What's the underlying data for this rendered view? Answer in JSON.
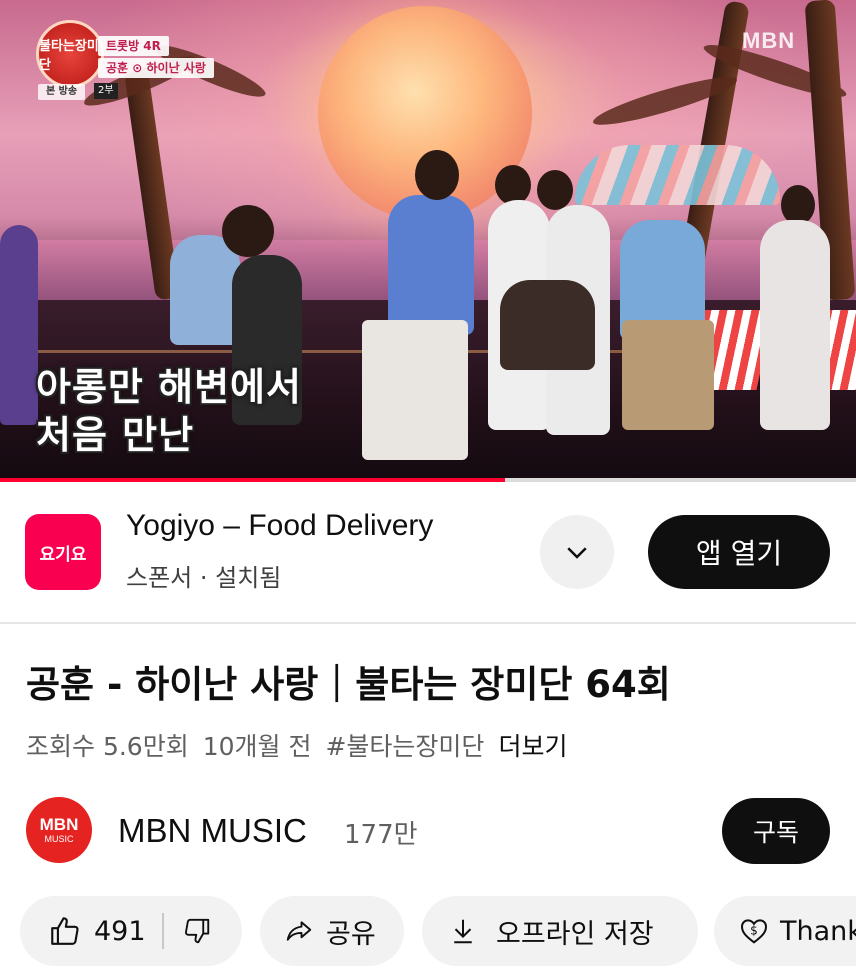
{
  "video": {
    "show_logo_text": "불타는장미단",
    "round_tag": "트롯방 4R",
    "matchup_tag": "공훈 ⊙ 하이난 사랑",
    "broadcast_tag": "본 방송",
    "episode_part": "2부",
    "broadcaster_logo": "MBN",
    "caption_line1": "아롱만 해변에서",
    "caption_line2": "처음 만난",
    "progress_fraction": 0.59,
    "progress_color": "#ff0033"
  },
  "ad": {
    "logo_text": "요기요",
    "logo_color": "#fa0050",
    "title": "Yogiyo – Food Delivery",
    "subtitle": "스폰서 · 설치됨",
    "expand_icon": "chevron-down-icon",
    "open_label": "앱 열기"
  },
  "title": "공훈 - 하이난 사랑｜불타는 장미단 64회",
  "meta": {
    "views": "조회수 5.6만회",
    "age": "10개월 전",
    "hashtag": "#불타는장미단",
    "more": "더보기"
  },
  "channel": {
    "avatar_line1": "MBN",
    "avatar_line2": "MUSIC",
    "avatar_color": "#e52321",
    "name": "MBN MUSIC",
    "subscribers": "177만",
    "subscribe_label": "구독"
  },
  "actions": {
    "like_count": "491",
    "like_icon": "thumbs-up-icon",
    "dislike_icon": "thumbs-down-icon",
    "share_label": "공유",
    "share_icon": "share-icon",
    "download_label": "오프라인 저장",
    "download_icon": "download-icon",
    "thanks_label": "Thank",
    "thanks_icon": "heart-dollar-icon"
  }
}
